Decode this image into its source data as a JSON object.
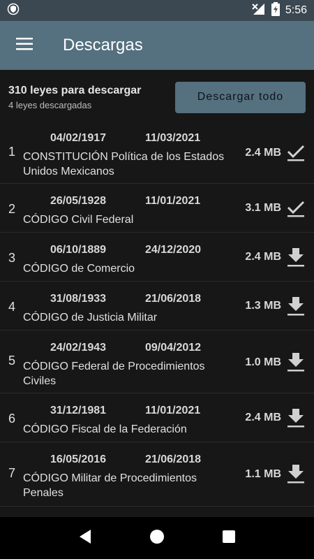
{
  "status_bar": {
    "time": "5:56"
  },
  "app_bar": {
    "title": "Descargas"
  },
  "summary": {
    "primary": "310 leyes para descargar",
    "secondary": "4 leyes descargadas",
    "download_all_label": "Descargar todo"
  },
  "laws": [
    {
      "index": "1",
      "date_published": "04/02/1917",
      "date_reformed": "11/03/2021",
      "title": "CONSTITUCIÓN Política de los Estados Unidos Mexicanos",
      "size": "2.4 MB",
      "status": "downloaded"
    },
    {
      "index": "2",
      "date_published": "26/05/1928",
      "date_reformed": "11/01/2021",
      "title": "CÓDIGO Civil Federal",
      "size": "3.1 MB",
      "status": "downloaded"
    },
    {
      "index": "3",
      "date_published": "06/10/1889",
      "date_reformed": "24/12/2020",
      "title": "CÓDIGO de Comercio",
      "size": "2.4 MB",
      "status": "pending"
    },
    {
      "index": "4",
      "date_published": "31/08/1933",
      "date_reformed": "21/06/2018",
      "title": "CÓDIGO de Justicia Militar",
      "size": "1.3 MB",
      "status": "pending"
    },
    {
      "index": "5",
      "date_published": "24/02/1943",
      "date_reformed": "09/04/2012",
      "title": "CÓDIGO Federal de Procedimientos Civiles",
      "size": "1.0 MB",
      "status": "pending"
    },
    {
      "index": "6",
      "date_published": "31/12/1981",
      "date_reformed": "11/01/2021",
      "title": "CÓDIGO Fiscal de la Federación",
      "size": "2.4 MB",
      "status": "pending"
    },
    {
      "index": "7",
      "date_published": "16/05/2016",
      "date_reformed": "21/06/2018",
      "title": "CÓDIGO Militar de Procedimientos Penales",
      "size": "1.1 MB",
      "status": "pending"
    }
  ],
  "icons": {
    "downloaded": "check-icon",
    "pending": "download-icon"
  },
  "colors": {
    "app_bar": "#55707f",
    "status_bar": "#3b4852",
    "background": "#171717",
    "icon": "#d0d0d0"
  }
}
